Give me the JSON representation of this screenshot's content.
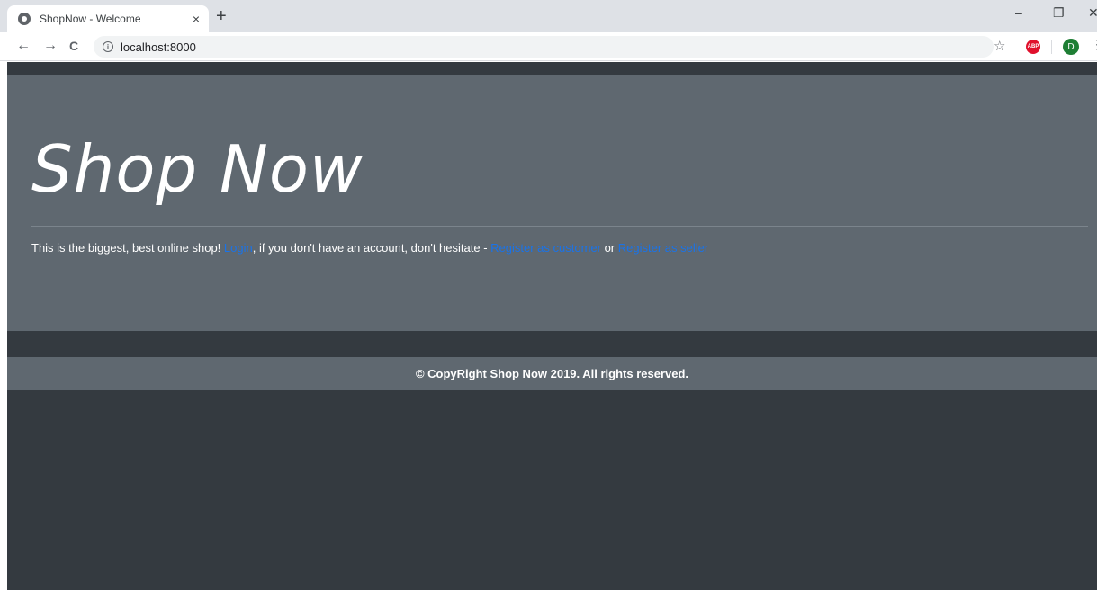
{
  "browser": {
    "tab_title": "ShopNow - Welcome",
    "tab_close": "×",
    "new_tab": "+",
    "url": "localhost:8000",
    "back": "←",
    "forward": "→",
    "reload": "C",
    "star": "☆",
    "abp": "ABP",
    "profile_initial": "D",
    "menu": "⋮",
    "minimize": "–",
    "restore": "❐",
    "close": "✕",
    "icons": [
      "globe-icon",
      "info-icon",
      "star-icon",
      "adblock-icon",
      "profile-avatar"
    ]
  },
  "page": {
    "title": "Shop Now",
    "lead": {
      "text1": "This is the biggest, best online shop! ",
      "login": "Login",
      "text2": ", if you don't have an account, don't hesitate - ",
      "register_customer": "Register as customer",
      "text3": " or ",
      "register_seller": "Register as seller"
    },
    "footer": "© CopyRight Shop Now 2019. All rights reserved."
  },
  "colors": {
    "background": "#343a40",
    "jumbotron": "#5f6870",
    "link": "#1a73e8"
  }
}
